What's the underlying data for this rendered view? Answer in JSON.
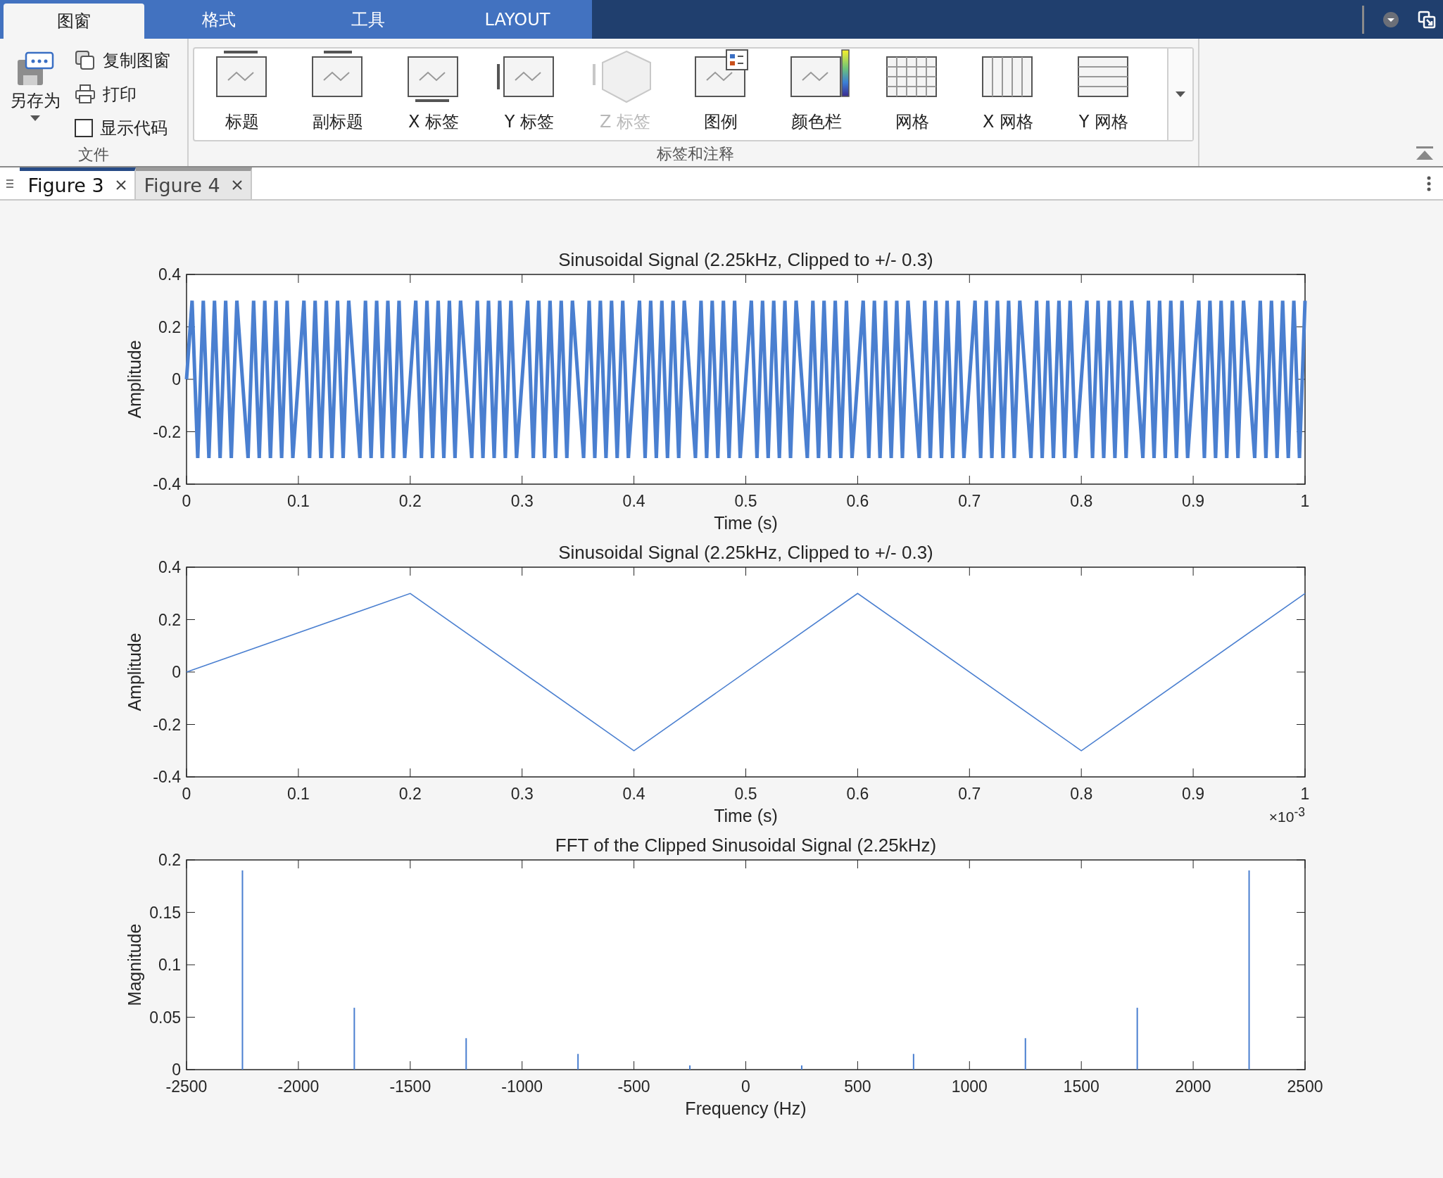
{
  "ribbon_tabs": [
    {
      "label": "图窗",
      "selected": true
    },
    {
      "label": "格式",
      "selected": false
    },
    {
      "label": "工具",
      "selected": false
    },
    {
      "label": "LAYOUT",
      "selected": false
    }
  ],
  "file_group": {
    "save_as": "另存为",
    "items": [
      {
        "kind": "copy",
        "label": "复制图窗"
      },
      {
        "kind": "print",
        "label": "打印"
      },
      {
        "kind": "checkbox",
        "label": "显示代码",
        "checked": false
      }
    ],
    "label": "文件"
  },
  "gallery": {
    "items": [
      {
        "kind": "title",
        "label": "标题",
        "disabled": false
      },
      {
        "kind": "subtitle",
        "label": "副标题",
        "disabled": false
      },
      {
        "kind": "xlabel",
        "label": "X 标签",
        "disabled": false
      },
      {
        "kind": "ylabel",
        "label": "Y 标签",
        "disabled": false
      },
      {
        "kind": "zlabel",
        "label": "Z 标签",
        "disabled": true
      },
      {
        "kind": "legend",
        "label": "图例",
        "disabled": false
      },
      {
        "kind": "colorbar",
        "label": "颜色栏",
        "disabled": false
      },
      {
        "kind": "grid",
        "label": "网格",
        "disabled": false
      },
      {
        "kind": "xgrid",
        "label": "X 网格",
        "disabled": false
      },
      {
        "kind": "ygrid",
        "label": "Y 网格",
        "disabled": false
      }
    ],
    "label": "标签和注释"
  },
  "document_tabs": [
    {
      "label": "Figure 3",
      "selected": true
    },
    {
      "label": "Figure 4",
      "selected": false
    }
  ],
  "plots": [
    {
      "chart_data": {
        "type": "line",
        "title": "Sinusoidal Signal (2.25kHz, Clipped to +/- 0.3)",
        "xlabel": "Time (s)",
        "ylabel": "Amplitude",
        "xlim": [
          0,
          1
        ],
        "ylim": [
          -0.4,
          0.4
        ],
        "xticks": [
          {
            "value": 0,
            "label": "0"
          },
          {
            "value": 0.1,
            "label": "0.1"
          },
          {
            "value": 0.2,
            "label": "0.2"
          },
          {
            "value": 0.3,
            "label": "0.3"
          },
          {
            "value": 0.4,
            "label": "0.4"
          },
          {
            "value": 0.5,
            "label": "0.5"
          },
          {
            "value": 0.6,
            "label": "0.6"
          },
          {
            "value": 0.7,
            "label": "0.7"
          },
          {
            "value": 0.8,
            "label": "0.8"
          },
          {
            "value": 0.9,
            "label": "0.9"
          },
          {
            "value": 1,
            "label": "1"
          }
        ],
        "yticks": [
          {
            "value": -0.4,
            "label": "-0.4"
          },
          {
            "value": -0.2,
            "label": "-0.2"
          },
          {
            "value": 0,
            "label": "0"
          },
          {
            "value": 0.2,
            "label": "0.2"
          },
          {
            "value": 0.4,
            "label": "0.4"
          }
        ],
        "x": [
          0,
          0.005,
          0.01,
          0.015,
          0.02,
          0.025,
          0.03,
          0.035,
          0.04,
          0.045,
          0.05,
          0.055,
          0.06,
          0.065,
          0.07,
          0.075,
          0.08,
          0.085,
          0.09,
          0.095,
          0.1,
          0.105,
          0.11,
          0.115,
          0.12,
          0.125,
          0.13,
          0.135,
          0.14,
          0.145,
          0.15,
          0.155,
          0.16,
          0.165,
          0.17,
          0.175,
          0.18,
          0.185,
          0.19,
          0.195,
          0.2,
          0.205,
          0.21,
          0.215,
          0.22,
          0.225,
          0.23,
          0.235,
          0.24,
          0.245,
          0.25,
          0.255,
          0.26,
          0.265,
          0.27,
          0.275,
          0.28,
          0.285,
          0.29,
          0.295,
          0.3,
          0.305,
          0.31,
          0.315,
          0.32,
          0.325,
          0.33,
          0.335,
          0.34,
          0.345,
          0.35,
          0.355,
          0.36,
          0.365,
          0.37,
          0.375,
          0.38,
          0.385,
          0.39,
          0.395,
          0.4,
          0.405,
          0.41,
          0.415,
          0.42,
          0.425,
          0.43,
          0.435,
          0.44,
          0.445,
          0.45,
          0.455,
          0.46,
          0.465,
          0.47,
          0.475,
          0.48,
          0.485,
          0.49,
          0.495,
          0.5,
          0.505,
          0.51,
          0.515,
          0.52,
          0.525,
          0.53,
          0.535,
          0.54,
          0.545,
          0.55,
          0.555,
          0.56,
          0.565,
          0.57,
          0.575,
          0.58,
          0.585,
          0.59,
          0.595,
          0.6,
          0.605,
          0.61,
          0.615,
          0.62,
          0.625,
          0.63,
          0.635,
          0.64,
          0.645,
          0.65,
          0.655,
          0.66,
          0.665,
          0.67,
          0.675,
          0.68,
          0.685,
          0.69,
          0.695,
          0.7,
          0.705,
          0.71,
          0.715,
          0.72,
          0.725,
          0.73,
          0.735,
          0.74,
          0.745,
          0.75,
          0.755,
          0.76,
          0.765,
          0.77,
          0.775,
          0.78,
          0.785,
          0.79,
          0.795,
          0.8,
          0.805,
          0.81,
          0.815,
          0.82,
          0.825,
          0.83,
          0.835,
          0.84,
          0.845,
          0.85,
          0.855,
          0.86,
          0.865,
          0.87,
          0.875,
          0.88,
          0.885,
          0.89,
          0.895,
          0.9,
          0.905,
          0.91,
          0.915,
          0.92,
          0.925,
          0.93,
          0.935,
          0.94,
          0.945,
          0.95,
          0.955,
          0.96,
          0.965,
          0.97,
          0.975,
          0.98,
          0.985,
          0.99,
          0.995,
          1
        ],
        "series": [
          {
            "color": "#4a7fd0",
            "values": [
              0,
              0.3,
              -0.3,
              0.3,
              -0.3,
              0.3,
              -0.3,
              0.3,
              -0.3,
              0.3,
              0,
              -0.3,
              0.3,
              -0.3,
              0.3,
              -0.3,
              0.3,
              -0.3,
              0.3,
              -0.3,
              0,
              0.3,
              -0.3,
              0.3,
              -0.3,
              0.3,
              -0.3,
              0.3,
              -0.3,
              0.3,
              0,
              -0.3,
              0.3,
              -0.3,
              0.3,
              -0.3,
              0.3,
              -0.3,
              0.3,
              -0.3,
              0,
              0.3,
              -0.3,
              0.3,
              -0.3,
              0.3,
              -0.3,
              0.3,
              -0.3,
              0.3,
              0,
              -0.3,
              0.3,
              -0.3,
              0.3,
              -0.3,
              0.3,
              -0.3,
              0.3,
              -0.3,
              0,
              0.3,
              -0.3,
              0.3,
              -0.3,
              0.3,
              -0.3,
              0.3,
              -0.3,
              0.3,
              0,
              -0.3,
              0.3,
              -0.3,
              0.3,
              -0.3,
              0.3,
              -0.3,
              0.3,
              -0.3,
              0,
              0.3,
              -0.3,
              0.3,
              -0.3,
              0.3,
              -0.3,
              0.3,
              -0.3,
              0.3,
              0,
              -0.3,
              0.3,
              -0.3,
              0.3,
              -0.3,
              0.3,
              -0.3,
              0.3,
              -0.3,
              0,
              0.3,
              -0.3,
              0.3,
              -0.3,
              0.3,
              -0.3,
              0.3,
              -0.3,
              0.3,
              0,
              -0.3,
              0.3,
              -0.3,
              0.3,
              -0.3,
              0.3,
              -0.3,
              0.3,
              -0.3,
              0,
              0.3,
              -0.3,
              0.3,
              -0.3,
              0.3,
              -0.3,
              0.3,
              -0.3,
              0.3,
              0,
              -0.3,
              0.3,
              -0.3,
              0.3,
              -0.3,
              0.3,
              -0.3,
              0.3,
              -0.3,
              0,
              0.3,
              -0.3,
              0.3,
              -0.3,
              0.3,
              -0.3,
              0.3,
              -0.3,
              0.3,
              0,
              -0.3,
              0.3,
              -0.3,
              0.3,
              -0.3,
              0.3,
              -0.3,
              0.3,
              -0.3,
              0,
              0.3,
              -0.3,
              0.3,
              -0.3,
              0.3,
              -0.3,
              0.3,
              -0.3,
              0.3,
              0,
              -0.3,
              0.3,
              -0.3,
              0.3,
              -0.3,
              0.3,
              -0.3,
              0.3,
              -0.3,
              0,
              0.3,
              -0.3,
              0.3,
              -0.3,
              0.3,
              -0.3,
              0.3,
              -0.3,
              0.3,
              0,
              -0.3,
              0.3,
              -0.3,
              0.3,
              -0.3,
              0.3,
              -0.3,
              0.3,
              -0.3,
              0.3
            ]
          }
        ]
      }
    },
    {
      "chart_data": {
        "type": "line",
        "title": "Sinusoidal Signal (2.25kHz, Clipped to +/- 0.3)",
        "xlabel": "Time (s)",
        "ylabel": "Amplitude",
        "xlim": [
          0,
          1
        ],
        "ylim": [
          -0.4,
          0.4
        ],
        "xticks": [
          {
            "value": 0,
            "label": "0"
          },
          {
            "value": 0.1,
            "label": "0.1"
          },
          {
            "value": 0.2,
            "label": "0.2"
          },
          {
            "value": 0.3,
            "label": "0.3"
          },
          {
            "value": 0.4,
            "label": "0.4"
          },
          {
            "value": 0.5,
            "label": "0.5"
          },
          {
            "value": 0.6,
            "label": "0.6"
          },
          {
            "value": 0.7,
            "label": "0.7"
          },
          {
            "value": 0.8,
            "label": "0.8"
          },
          {
            "value": 0.9,
            "label": "0.9"
          },
          {
            "value": 1,
            "label": "1"
          }
        ],
        "yticks": [
          {
            "value": -0.4,
            "label": "-0.4"
          },
          {
            "value": -0.2,
            "label": "-0.2"
          },
          {
            "value": 0,
            "label": "0"
          },
          {
            "value": 0.2,
            "label": "0.2"
          },
          {
            "value": 0.4,
            "label": "0.4"
          }
        ],
        "x": [
          0,
          0.2,
          0.4,
          0.6,
          0.8,
          1
        ],
        "series": [
          {
            "color": "#4a7fd0",
            "values": [
              0,
              0.3,
              -0.3,
              0.3,
              -0.3,
              0.3
            ]
          }
        ],
        "annotations": [
          "×10$^{-3}$"
        ]
      }
    },
    {
      "chart_data": {
        "type": "bar",
        "title": "FFT of the Clipped Sinusoidal Signal (2.25kHz)",
        "xlabel": "Frequency (Hz)",
        "ylabel": "Magnitude",
        "xlim": [
          -2500,
          2500
        ],
        "ylim": [
          0,
          0.2
        ],
        "xticks": [
          -2500,
          -2000,
          -1500,
          -1000,
          -500,
          0,
          500,
          1000,
          1500,
          2000,
          2500
        ],
        "yticks": [
          {
            "value": 0,
            "label": "0"
          },
          {
            "value": 0.05,
            "label": "0.05"
          },
          {
            "value": 0.1,
            "label": "0.1"
          },
          {
            "value": 0.15,
            "label": "0.15"
          },
          {
            "value": 0.2,
            "label": "0.2"
          }
        ],
        "x": [
          -2250,
          -1750,
          -1250,
          -750,
          -250,
          250,
          750,
          1250,
          1750,
          2250
        ],
        "series": [
          {
            "color": "#4a7fd0",
            "values": [
              0.19,
              0.059,
              0.03,
              0.015,
              0.004,
              0.004,
              0.015,
              0.03,
              0.059,
              0.19
            ]
          }
        ]
      }
    }
  ]
}
